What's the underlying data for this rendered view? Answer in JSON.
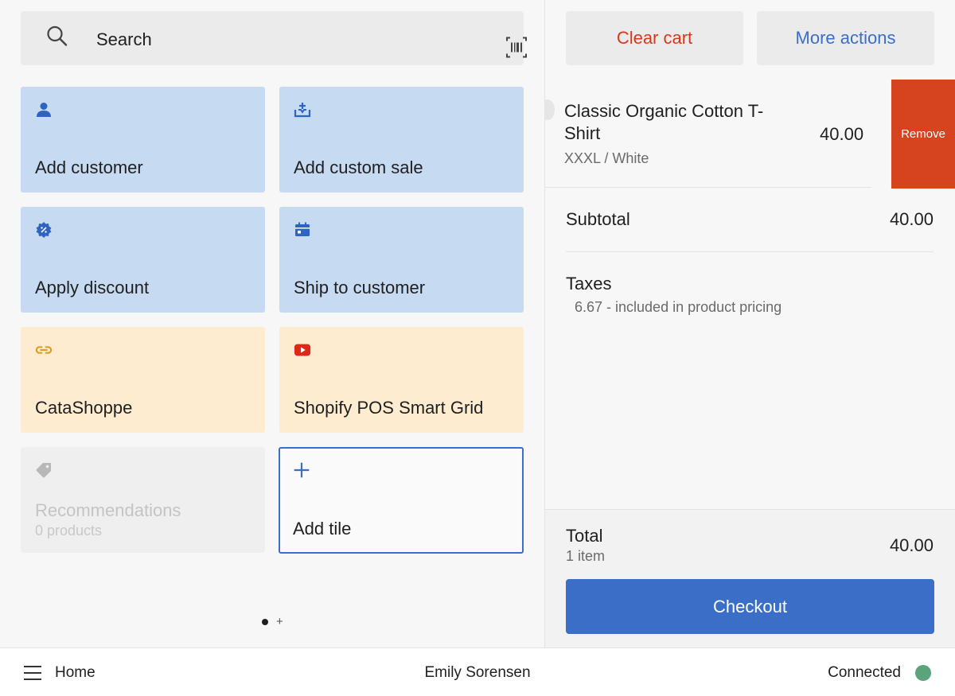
{
  "search": {
    "label": "Search",
    "icon": "search-icon",
    "scan_icon": "barcode-scan-icon"
  },
  "tiles": [
    {
      "label": "Add customer",
      "icon": "person-icon"
    },
    {
      "label": "Add custom sale",
      "icon": "add-custom-sale-icon"
    },
    {
      "label": "Apply discount",
      "icon": "discount-badge-icon"
    },
    {
      "label": "Ship to customer",
      "icon": "ship-calendar-icon"
    },
    {
      "label": "CataShoppe",
      "icon": "link-icon"
    },
    {
      "label": "Shopify POS Smart Grid",
      "icon": "youtube-play-icon"
    },
    {
      "label": "Recommendations",
      "sub": "0 products",
      "icon": "tag-icon"
    },
    {
      "label": "Add tile",
      "icon": "plus-icon"
    }
  ],
  "pager": {
    "plus": "+"
  },
  "cart": {
    "clear_label": "Clear cart",
    "more_label": "More actions",
    "item": {
      "name": "Classic Organic Cotton T-Shirt",
      "variant": "XXXL / White",
      "price": "40.00",
      "remove_label": "Remove"
    },
    "subtotal_label": "Subtotal",
    "subtotal_value": "40.00",
    "taxes_label": "Taxes",
    "taxes_detail": "6.67 - included in product pricing",
    "total_label": "Total",
    "total_count": "1 item",
    "total_value": "40.00",
    "checkout_label": "Checkout"
  },
  "footer": {
    "home_label": "Home",
    "user_name": "Emily Sorensen",
    "connection_label": "Connected"
  },
  "colors": {
    "accent_blue": "#3b6ec7",
    "danger_red": "#d6391c",
    "tile_blue": "#c6daf2",
    "tile_yellow": "#fdecd0",
    "status_green": "#5aa37b"
  }
}
